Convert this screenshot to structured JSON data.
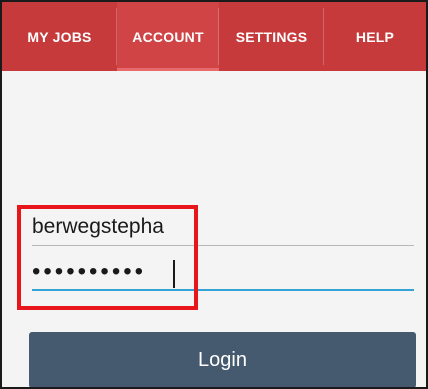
{
  "tabs": [
    {
      "label": "MY JOBS"
    },
    {
      "label": "ACCOUNT"
    },
    {
      "label": "SETTINGS"
    },
    {
      "label": "HELP"
    }
  ],
  "active_tab": "ACCOUNT",
  "login_form": {
    "username_value": "berwegstepha",
    "password_masked": "••••••••••",
    "login_label": "Login"
  },
  "colors": {
    "tabbar": "#c63a3c",
    "active_tab": "#d04446",
    "focus_underline": "#33a3d6",
    "button": "#455a6e",
    "highlight": "#e8161b"
  }
}
